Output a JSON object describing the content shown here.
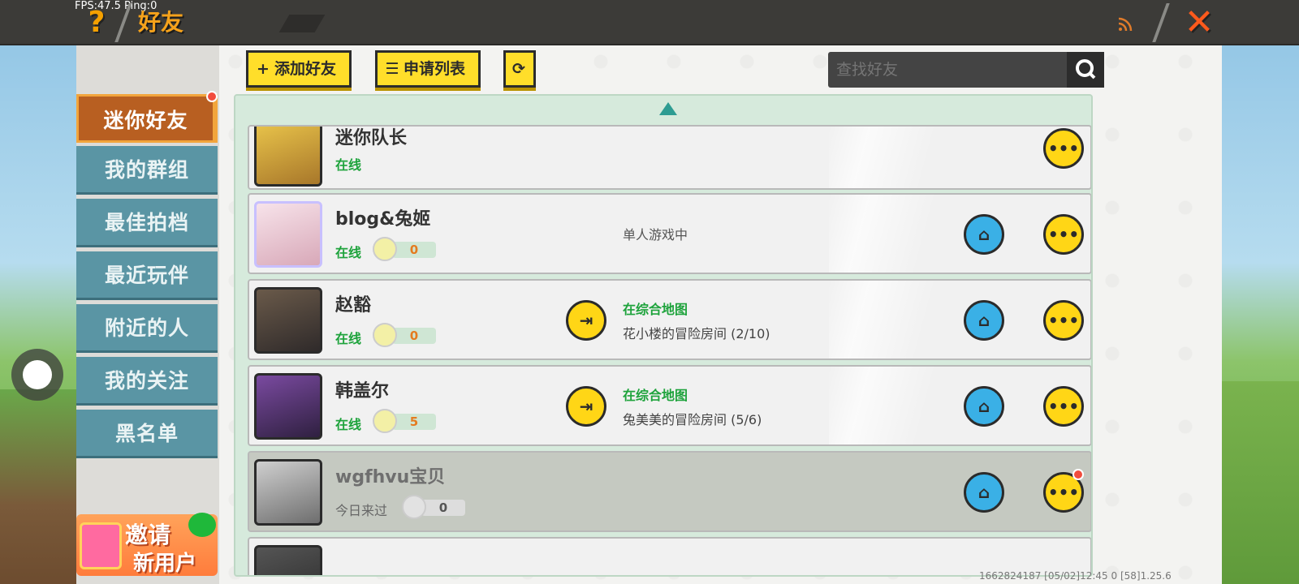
{
  "topbar": {
    "fps_text": "FPS:47.5  Ping:0",
    "title": "好友"
  },
  "sidebar": {
    "items": [
      {
        "label": "迷你好友",
        "active": true
      },
      {
        "label": "我的群组"
      },
      {
        "label": "最佳拍档"
      },
      {
        "label": "最近玩伴"
      },
      {
        "label": "附近的人"
      },
      {
        "label": "我的关注"
      },
      {
        "label": "黑名单"
      }
    ],
    "invite": {
      "line1": "邀请",
      "line2": "新用户"
    }
  },
  "toolbar": {
    "add_friend_label": "添加好友",
    "request_list_label": "申请列表",
    "search_placeholder": "查找好友"
  },
  "friends": [
    {
      "name": "迷你队长",
      "status": "在线",
      "has_badge": false
    },
    {
      "name": "blog&兔姬",
      "status": "在线",
      "points": "0",
      "game_state": "单人游戏中"
    },
    {
      "name": "赵豁",
      "status": "在线",
      "points": "0",
      "map": "在综合地图",
      "room": "花小楼的冒险房间 (2/10)"
    },
    {
      "name": "韩盖尔",
      "status": "在线",
      "points": "5",
      "map": "在综合地图",
      "room": "兔美美的冒险房间 (5/6)"
    },
    {
      "name": "wgfhvu宝贝",
      "status": "今日来过",
      "points": "0"
    }
  ],
  "footer": {
    "id_text": "1662824187  [05/02]12:45 0  [58]1.25.6"
  },
  "colors": {
    "accent_yellow": "#ffde2a",
    "active_tab": "#b85f21",
    "tab": "#5a95a4",
    "online_green": "#1ea33c"
  }
}
